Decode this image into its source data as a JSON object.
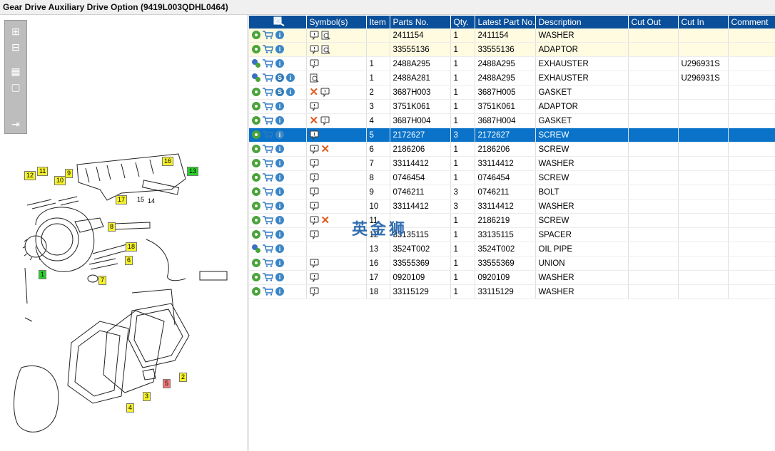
{
  "window": {
    "title": "Gear Drive Auxiliary Drive Option (9419L003QDHL0464)"
  },
  "toolbar": {
    "buttons": [
      {
        "name": "zoom-in-button",
        "icon": "zoom-in-icon",
        "glyph": "⊞"
      },
      {
        "name": "zoom-out-button",
        "icon": "zoom-out-icon",
        "glyph": "⊟"
      },
      {
        "name": "fit-all-button",
        "icon": "fit-all-icon",
        "glyph": "▦"
      },
      {
        "name": "fit-window-button",
        "icon": "fit-window-icon",
        "glyph": "▢"
      },
      {
        "name": "export-button",
        "icon": "export-icon",
        "glyph": "⇥"
      }
    ]
  },
  "watermark": "英金狮",
  "grid": {
    "columns": [
      "",
      "Symbol(s)",
      "Item",
      "Parts No.",
      "Qty.",
      "Latest Part No.",
      "Description",
      "Cut Out",
      "Cut In",
      "Comment"
    ],
    "rows": [
      {
        "actions": [
          "gear",
          "cart",
          "info"
        ],
        "symbols": [
          "note",
          "doc"
        ],
        "item": "",
        "part": "2411154",
        "qty": "1",
        "latest": "2411154",
        "desc": "WASHER",
        "cutout": "",
        "cutin": "",
        "comment": "",
        "style": "alt"
      },
      {
        "actions": [
          "gear",
          "cart",
          "info"
        ],
        "symbols": [
          "note",
          "doc"
        ],
        "item": "",
        "part": "33555136",
        "qty": "1",
        "latest": "33555136",
        "desc": "ADAPTOR",
        "cutout": "",
        "cutin": "",
        "comment": "",
        "style": "alt"
      },
      {
        "actions": [
          "gear2",
          "cart",
          "info"
        ],
        "symbols": [
          "note"
        ],
        "item": "1",
        "part": "2488A295",
        "qty": "1",
        "latest": "2488A295",
        "desc": "EXHAUSTER",
        "cutout": "",
        "cutin": "U296931S",
        "comment": "",
        "style": ""
      },
      {
        "actions": [
          "gear2",
          "cart",
          "s",
          "info"
        ],
        "symbols": [
          "doc"
        ],
        "item": "1",
        "part": "2488A281",
        "qty": "1",
        "latest": "2488A295",
        "desc": "EXHAUSTER",
        "cutout": "",
        "cutin": "U296931S",
        "comment": "",
        "style": ""
      },
      {
        "actions": [
          "gear",
          "cart",
          "s",
          "info"
        ],
        "symbols": [
          "x",
          "note"
        ],
        "item": "2",
        "part": "3687H003",
        "qty": "1",
        "latest": "3687H005",
        "desc": "GASKET",
        "cutout": "",
        "cutin": "",
        "comment": "",
        "style": ""
      },
      {
        "actions": [
          "gear",
          "cart",
          "info"
        ],
        "symbols": [
          "note"
        ],
        "item": "3",
        "part": "3751K061",
        "qty": "1",
        "latest": "3751K061",
        "desc": "ADAPTOR",
        "cutout": "",
        "cutin": "",
        "comment": "",
        "style": ""
      },
      {
        "actions": [
          "gear",
          "cart",
          "info"
        ],
        "symbols": [
          "x",
          "note"
        ],
        "item": "4",
        "part": "3687H004",
        "qty": "1",
        "latest": "3687H004",
        "desc": "GASKET",
        "cutout": "",
        "cutin": "",
        "comment": "",
        "style": ""
      },
      {
        "actions": [
          "gear",
          "cart",
          "info"
        ],
        "symbols": [
          "note"
        ],
        "item": "5",
        "part": "2172627",
        "qty": "3",
        "latest": "2172627",
        "desc": "SCREW",
        "cutout": "",
        "cutin": "",
        "comment": "",
        "style": "sel"
      },
      {
        "actions": [
          "gear",
          "cart",
          "info"
        ],
        "symbols": [
          "note",
          "x"
        ],
        "item": "6",
        "part": "2186206",
        "qty": "1",
        "latest": "2186206",
        "desc": "SCREW",
        "cutout": "",
        "cutin": "",
        "comment": "",
        "style": ""
      },
      {
        "actions": [
          "gear",
          "cart",
          "info"
        ],
        "symbols": [
          "note"
        ],
        "item": "7",
        "part": "33114412",
        "qty": "1",
        "latest": "33114412",
        "desc": "WASHER",
        "cutout": "",
        "cutin": "",
        "comment": "",
        "style": ""
      },
      {
        "actions": [
          "gear",
          "cart",
          "info"
        ],
        "symbols": [
          "note"
        ],
        "item": "8",
        "part": "0746454",
        "qty": "1",
        "latest": "0746454",
        "desc": "SCREW",
        "cutout": "",
        "cutin": "",
        "comment": "",
        "style": ""
      },
      {
        "actions": [
          "gear",
          "cart",
          "info"
        ],
        "symbols": [
          "note"
        ],
        "item": "9",
        "part": "0746211",
        "qty": "3",
        "latest": "0746211",
        "desc": "BOLT",
        "cutout": "",
        "cutin": "",
        "comment": "",
        "style": ""
      },
      {
        "actions": [
          "gear",
          "cart",
          "info"
        ],
        "symbols": [
          "note"
        ],
        "item": "10",
        "part": "33114412",
        "qty": "3",
        "latest": "33114412",
        "desc": "WASHER",
        "cutout": "",
        "cutin": "",
        "comment": "",
        "style": ""
      },
      {
        "actions": [
          "gear",
          "cart",
          "info"
        ],
        "symbols": [
          "note",
          "x"
        ],
        "item": "11",
        "part": "",
        "qty": "1",
        "latest": "2186219",
        "desc": "SCREW",
        "cutout": "",
        "cutin": "",
        "comment": "",
        "style": ""
      },
      {
        "actions": [
          "gear",
          "cart",
          "info"
        ],
        "symbols": [
          "note"
        ],
        "item": "12",
        "part": "33135115",
        "qty": "1",
        "latest": "33135115",
        "desc": "SPACER",
        "cutout": "",
        "cutin": "",
        "comment": "",
        "style": ""
      },
      {
        "actions": [
          "gear2",
          "cart",
          "info"
        ],
        "symbols": [],
        "item": "13",
        "part": "3524T002",
        "qty": "1",
        "latest": "3524T002",
        "desc": "OIL PIPE",
        "cutout": "",
        "cutin": "",
        "comment": "",
        "style": ""
      },
      {
        "actions": [
          "gear",
          "cart",
          "info"
        ],
        "symbols": [
          "note"
        ],
        "item": "16",
        "part": "33555369",
        "qty": "1",
        "latest": "33555369",
        "desc": "UNION",
        "cutout": "",
        "cutin": "",
        "comment": "",
        "style": ""
      },
      {
        "actions": [
          "gear",
          "cart",
          "info"
        ],
        "symbols": [
          "note"
        ],
        "item": "17",
        "part": "0920109",
        "qty": "1",
        "latest": "0920109",
        "desc": "WASHER",
        "cutout": "",
        "cutin": "",
        "comment": "",
        "style": ""
      },
      {
        "actions": [
          "gear",
          "cart",
          "info"
        ],
        "symbols": [
          "note"
        ],
        "item": "18",
        "part": "33115129",
        "qty": "1",
        "latest": "33115129",
        "desc": "WASHER",
        "cutout": "",
        "cutin": "",
        "comment": "",
        "style": ""
      }
    ]
  },
  "diagram": {
    "callouts": [
      {
        "label": "12",
        "color": "yellow"
      },
      {
        "label": "11",
        "color": "yellow"
      },
      {
        "label": "10",
        "color": "yellow"
      },
      {
        "label": "9",
        "color": "yellow"
      },
      {
        "label": "16",
        "color": "yellow"
      },
      {
        "label": "13",
        "color": "green"
      },
      {
        "label": "17",
        "color": "yellow"
      },
      {
        "label": "15",
        "color": "none"
      },
      {
        "label": "14",
        "color": "none"
      },
      {
        "label": "8",
        "color": "yellow"
      },
      {
        "label": "18",
        "color": "yellow"
      },
      {
        "label": "6",
        "color": "yellow"
      },
      {
        "label": "1",
        "color": "green"
      },
      {
        "label": "7",
        "color": "yellow"
      },
      {
        "label": "2",
        "color": "yellow"
      },
      {
        "label": "5",
        "color": "red"
      },
      {
        "label": "3",
        "color": "yellow"
      },
      {
        "label": "4",
        "color": "yellow"
      }
    ]
  },
  "colors": {
    "header": "#0a4f9a",
    "selected_row": "#0a73c9",
    "highlight_row": "#fefbe1"
  }
}
